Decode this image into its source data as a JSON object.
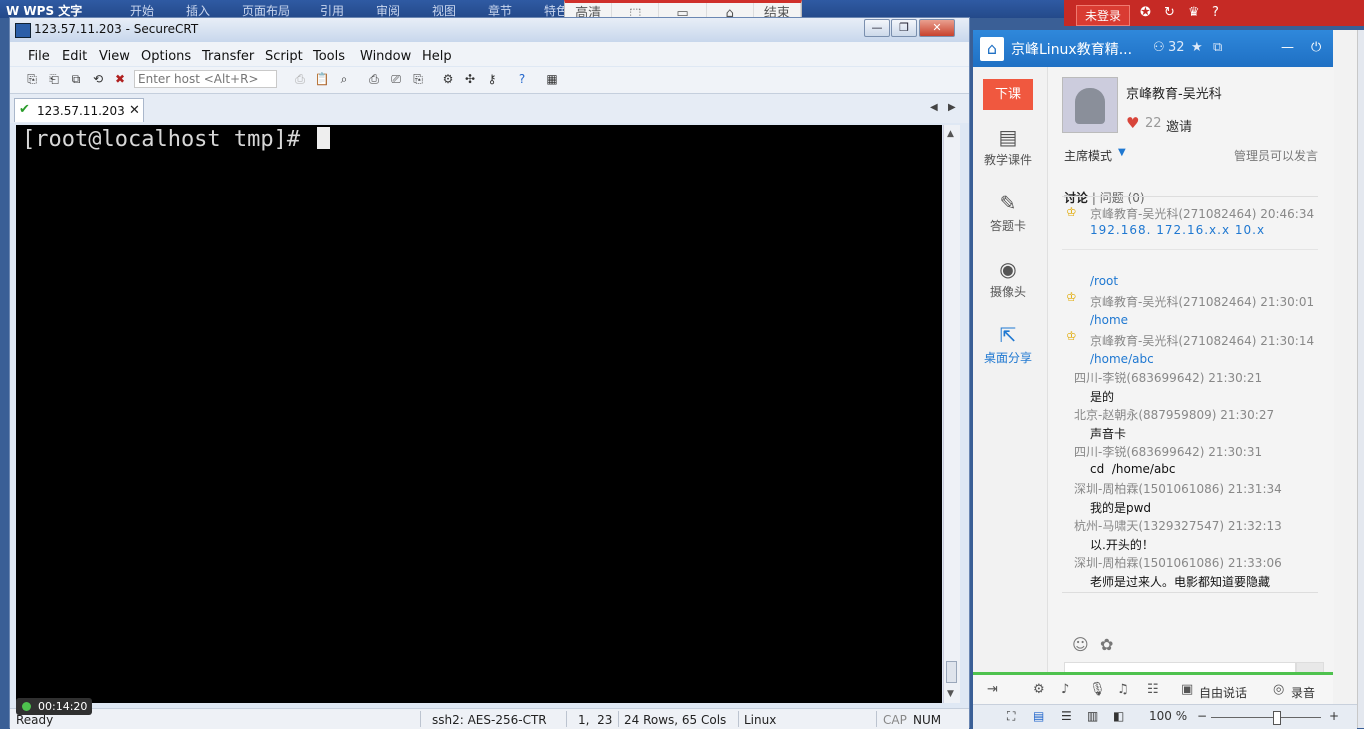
{
  "wps": {
    "logo": "W WPS 文字",
    "menu": [
      "开始",
      "插入",
      "页面布局",
      "引用",
      "审阅",
      "视图",
      "章节",
      "特色"
    ],
    "login": "未登录"
  },
  "share_bar": {
    "items": [
      "高清",
      "⬚",
      "▭",
      "⌂",
      "结束"
    ]
  },
  "crt": {
    "title": "123.57.11.203 - SecureCRT",
    "menu": [
      "File",
      "Edit",
      "View",
      "Options",
      "Transfer",
      "Script",
      "Tools",
      "Window",
      "Help"
    ],
    "host_placeholder": "Enter host <Alt+R>",
    "tab_label": "123.57.11.203",
    "prompt": "[root@localhost tmp]# ",
    "status": {
      "ready": "Ready",
      "cipher": "ssh2: AES-256-CTR",
      "position": "1,  23",
      "size": "24 Rows, 65 Cols",
      "os": "Linux",
      "cap": "CAP",
      "num": "NUM"
    },
    "timer": "00:14:20"
  },
  "panel": {
    "title": "京峰Linux教育精...",
    "user_count": "32",
    "end_class": "下课",
    "nav": [
      "教学课件",
      "答题卡",
      "摄像头",
      "桌面分享"
    ],
    "teacher": "京峰教育-吴光科",
    "likes": "22",
    "invite": "邀请",
    "mode": "主席模式",
    "admin_note": "管理员可以发言",
    "tab_discuss": "讨论",
    "tab_question": "问题",
    "question_count": "(0)",
    "messages": [
      {
        "meta": "京峰教育-吴光科(271082464) 20:46:34",
        "text": "192.168. 172.16.x.x 10.x"
      },
      {
        "text": "/root"
      },
      {
        "meta": "京峰教育-吴光科(271082464) 21:30:01"
      },
      {
        "text": "/home"
      },
      {
        "meta": "京峰教育-吴光科(271082464) 21:30:14"
      },
      {
        "text": "/home/abc"
      },
      {
        "meta": "四川-李锐(683699642) 21:30:21",
        "body": "是的"
      },
      {
        "meta": "北京-赵朝永(887959809) 21:30:27",
        "body": "声音卡"
      },
      {
        "meta": "四川-李锐(683699642) 21:30:31",
        "body": "cd  /home/abc"
      },
      {
        "meta": "深圳-周柏霖(1501061086) 21:31:34",
        "body": "我的是pwd"
      },
      {
        "meta": "杭州-马啸天(1329327547) 21:32:13",
        "body": "以.开头的！"
      },
      {
        "meta": "深圳-周柏霖(1501061086) 21:33:06",
        "body": "老师是过来人。电影都知道要隐藏"
      }
    ],
    "bottom": {
      "free_talk": "自由说话",
      "record": "录音"
    },
    "zoom": "100 %"
  }
}
